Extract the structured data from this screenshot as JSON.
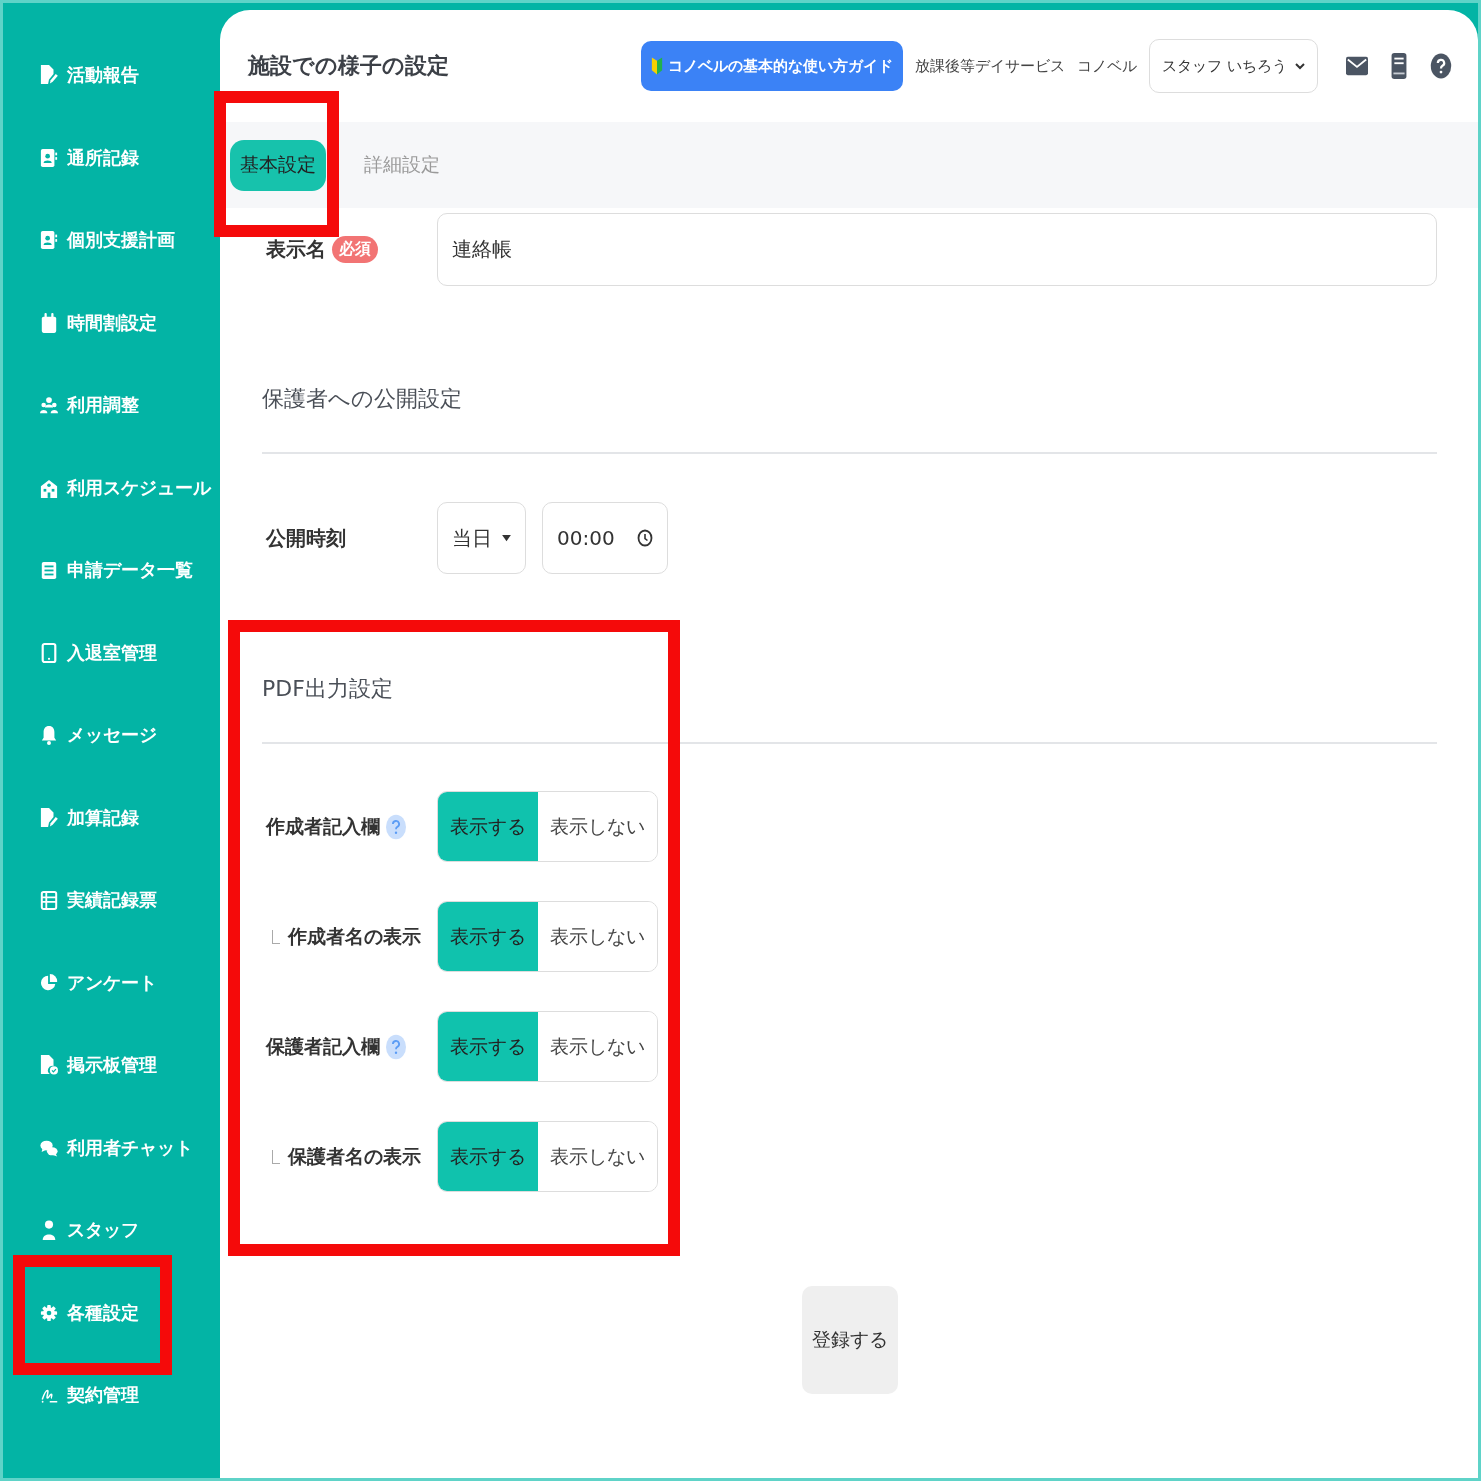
{
  "sidebar": {
    "items": [
      {
        "label": "活動報告",
        "highlighted": false
      },
      {
        "label": "通所記録",
        "highlighted": false
      },
      {
        "label": "個別支援計画",
        "highlighted": false
      },
      {
        "label": "時間割設定",
        "highlighted": false
      },
      {
        "label": "利用調整",
        "highlighted": false
      },
      {
        "label": "利用スケジュール",
        "highlighted": false
      },
      {
        "label": "申請データ一覧",
        "highlighted": false
      },
      {
        "label": "入退室管理",
        "highlighted": false
      },
      {
        "label": "メッセージ",
        "highlighted": false
      },
      {
        "label": "加算記録",
        "highlighted": false
      },
      {
        "label": "実績記録票",
        "highlighted": false
      },
      {
        "label": "アンケート",
        "highlighted": false
      },
      {
        "label": "掲示板管理",
        "highlighted": false
      },
      {
        "label": "利用者チャット",
        "highlighted": false
      },
      {
        "label": "スタッフ",
        "highlighted": false
      },
      {
        "label": "各種設定",
        "highlighted": true
      },
      {
        "label": "契約管理",
        "highlighted": false
      }
    ]
  },
  "header": {
    "title": "施設での様子の設定",
    "guide_button": "コノベルの基本的な使い方ガイド",
    "facility_type": "放課後等デイサービス",
    "facility_name": "コノベル",
    "user_menu": "スタッフ いちろう"
  },
  "tabs": [
    {
      "label": "基本設定",
      "selected": true,
      "highlighted": true
    },
    {
      "label": "詳細設定",
      "selected": false,
      "highlighted": false
    }
  ],
  "display_name": {
    "label": "表示名",
    "required_badge": "必須",
    "value": "連絡帳"
  },
  "guardian_publishing": {
    "heading": "保護者への公開設定",
    "publish_time": {
      "label": "公開時刻",
      "day": "当日",
      "time": "00:00"
    }
  },
  "pdf_output": {
    "heading": "PDF出力設定",
    "highlighted": true,
    "rows": [
      {
        "label": "作成者記入欄",
        "kind": "main",
        "help": true,
        "options": [
          {
            "label": "表示する",
            "selected": true
          },
          {
            "label": "表示しない",
            "selected": false
          }
        ]
      },
      {
        "label": "作成者名の表示",
        "kind": "sub",
        "help": false,
        "options": [
          {
            "label": "表示する",
            "selected": true
          },
          {
            "label": "表示しない",
            "selected": false
          }
        ]
      },
      {
        "label": "保護者記入欄",
        "kind": "main",
        "help": true,
        "options": [
          {
            "label": "表示する",
            "selected": true
          },
          {
            "label": "表示しない",
            "selected": false
          }
        ]
      },
      {
        "label": "保護者名の表示",
        "kind": "sub",
        "help": false,
        "options": [
          {
            "label": "表示する",
            "selected": true
          },
          {
            "label": "表示しない",
            "selected": false
          }
        ]
      }
    ]
  },
  "submit_button": "登録する"
}
